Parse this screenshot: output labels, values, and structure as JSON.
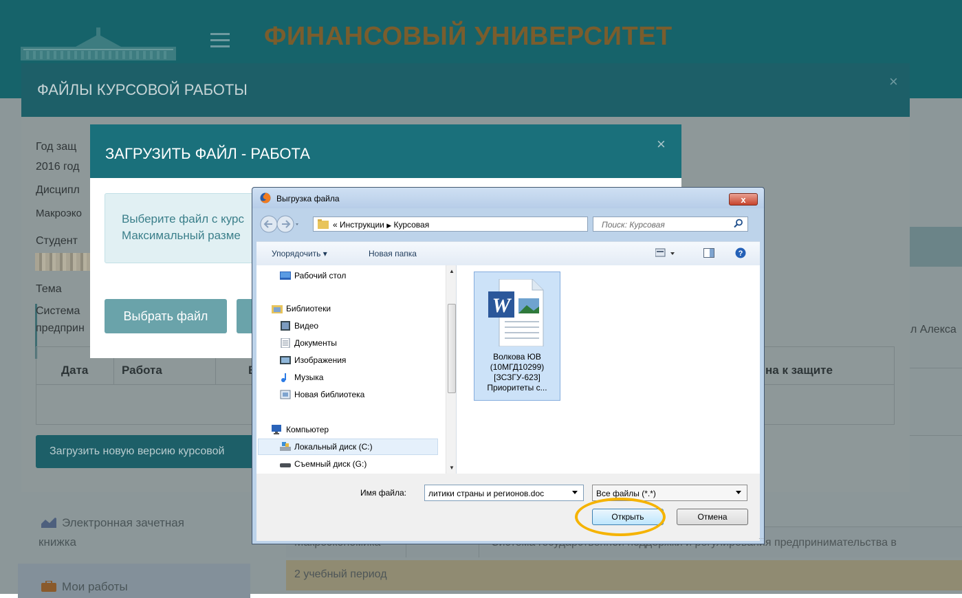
{
  "site": {
    "title": "ФИНАНСОВЫЙ УНИВЕРСИТЕТ"
  },
  "sidebar": {
    "items": [
      {
        "label": "Электронная зачетная книжка",
        "line1": "Электронная зачетная",
        "line2": "книжка",
        "icon": "chart-icon"
      },
      {
        "label": "Мои работы",
        "icon": "briefcase-icon"
      }
    ]
  },
  "background_table": {
    "row1": {
      "col1": "Макроэкономика",
      "col2": "",
      "col3": "Система государственной поддержки и регулирования предпринимательства в"
    },
    "row2": {
      "col1": "2 учебный период"
    },
    "right_text": "л Алекса"
  },
  "course_modal": {
    "title": "ФАЙЛЫ КУРСОВОЙ РАБОТЫ",
    "close": "×",
    "year_label": "Год защ",
    "year_value": "2016 год",
    "discipline_label": "Дисципл",
    "discipline_value": "Макроэко",
    "student_label": "Студент",
    "topic_label": "Тема",
    "topic_line1": "Система",
    "topic_line2": "предприн",
    "table_headers": [
      "Дата",
      "Работа",
      "В",
      "на к защите"
    ],
    "upload_button": "Загрузить новую версию курсовой"
  },
  "upload_modal": {
    "title": "ЗАГРУЗИТЬ ФАЙЛ - РАБОТА",
    "close": "×",
    "info_line1": "Выберите файл с курс",
    "info_line2": "Максимальный разме",
    "choose_button": "Выбрать файл"
  },
  "file_dialog": {
    "title": "Выгрузка файла",
    "close": "x",
    "path": {
      "prefix": "«",
      "segments": [
        "Инструкции",
        "Курсовая"
      ]
    },
    "search_placeholder": "Поиск: Курсовая",
    "toolbar": {
      "organize": "Упорядочить ▾",
      "new_folder": "Новая папка"
    },
    "tree": [
      {
        "label": "Рабочий стол",
        "icon": "desktop-icon"
      },
      {
        "label": "Библиотеки",
        "icon": "libraries-icon"
      },
      {
        "label": "Видео",
        "icon": "video-icon"
      },
      {
        "label": "Документы",
        "icon": "documents-icon"
      },
      {
        "label": "Изображения",
        "icon": "images-icon"
      },
      {
        "label": "Музыка",
        "icon": "music-icon"
      },
      {
        "label": "Новая библиотека",
        "icon": "library-icon"
      },
      {
        "label": "Компьютер",
        "icon": "computer-icon"
      },
      {
        "label": "Локальный диск (C:)",
        "icon": "local-disk-icon"
      },
      {
        "label": "Съемный диск (G:)",
        "icon": "removable-disk-icon"
      }
    ],
    "file": {
      "line1": "Волкова ЮВ",
      "line2": "(10МГД10299)",
      "line3": "[ЗСЗГУ-623]",
      "line4": "Приоритеты с..."
    },
    "filename_label": "Имя файла:",
    "filename_value": "литики страны и регионов.doc",
    "filter_value": "Все файлы (*.*)",
    "open_button": "Открыть",
    "cancel_button": "Отмена"
  },
  "colors": {
    "header_bg": "#16636a",
    "modal_header": "#1a707b",
    "highlight": "#f5b300"
  }
}
